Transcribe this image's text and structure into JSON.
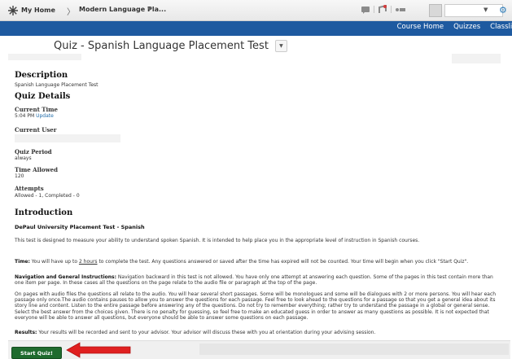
{
  "minibar": {
    "home_label": "My Home",
    "course_label": "Modern Language Pla...",
    "caret": "▼",
    "separator": "〉"
  },
  "nav": {
    "items": [
      "Course Home",
      "Quizzes",
      "Classlist"
    ]
  },
  "quiz": {
    "title": "Quiz - Spanish Language Placement Test",
    "caret": "▼"
  },
  "description": {
    "heading": "Description",
    "text": "Spanish Language Placement Test"
  },
  "details": {
    "heading": "Quiz Details",
    "current_time_label": "Current Time",
    "current_time_value": "5:04 PM",
    "update_link": "Update",
    "current_user_label": "Current User",
    "quiz_period_label": "Quiz Period",
    "quiz_period_value": "always",
    "time_allowed_label": "Time Allowed",
    "time_allowed_value": "120",
    "attempts_label": "Attempts",
    "attempts_value": "Allowed - 1, Completed - 0"
  },
  "introduction": {
    "heading": "Introduction",
    "subtitle": "DePaul University Placement Test  - Spanish",
    "p1": "This test is designed to measure your ability to understand spoken Spanish. It is intended to help place you in the appropriate level of instruction in Spanish courses.",
    "time_label": "Time:",
    "time_pre": " You will have up to ",
    "time_hours": "2 hours",
    "time_post": " to complete the test.  Any questions answered or saved after the time has expired will not be counted.  Your time will begin when you click \"Start Quiz\".",
    "nav_label": "Navigation and General Instructions:",
    "nav_text": " Navigation backward in this test is not allowed. You have only one attempt at answering each question. Some of the pages in this test contain more than one item per page. In these cases all the questions on the page relate to the audio file or paragraph at the top of the page.",
    "audio_text": "On pages with audio files the questions all relate to the audio.  You will hear several short passages. Some will be monologues and some will be dialogues with 2 or more persons.  You will hear each passage only once.The audio contains pauses to allow you to answer the questions for each passage. Feel free to look ahead to the questions for a passage so that you get a general idea about its story line and content. Listen to the entire passage before answering any of the questions. Do not try to remember everything; rather try to understand the passage in a global or general sense. Select the best answer from the choices given. There is no penalty for guessing, so feel free to make an educated guess in order to answer as many questions as possible. It is not expected that everyone will be able to answer all questions, but everyone should be able to answer some questions on each passage.",
    "results_label": "Results:",
    "results_text": " Your results will be recorded and sent to your advisor. Your advisor will discuss these with you at orientation during your advising session."
  },
  "footer": {
    "start_button": "Start Quiz!"
  },
  "colors": {
    "nav_bg": "#1e5aa0",
    "start_button": "#1f6b2e",
    "arrow": "#e02020"
  }
}
